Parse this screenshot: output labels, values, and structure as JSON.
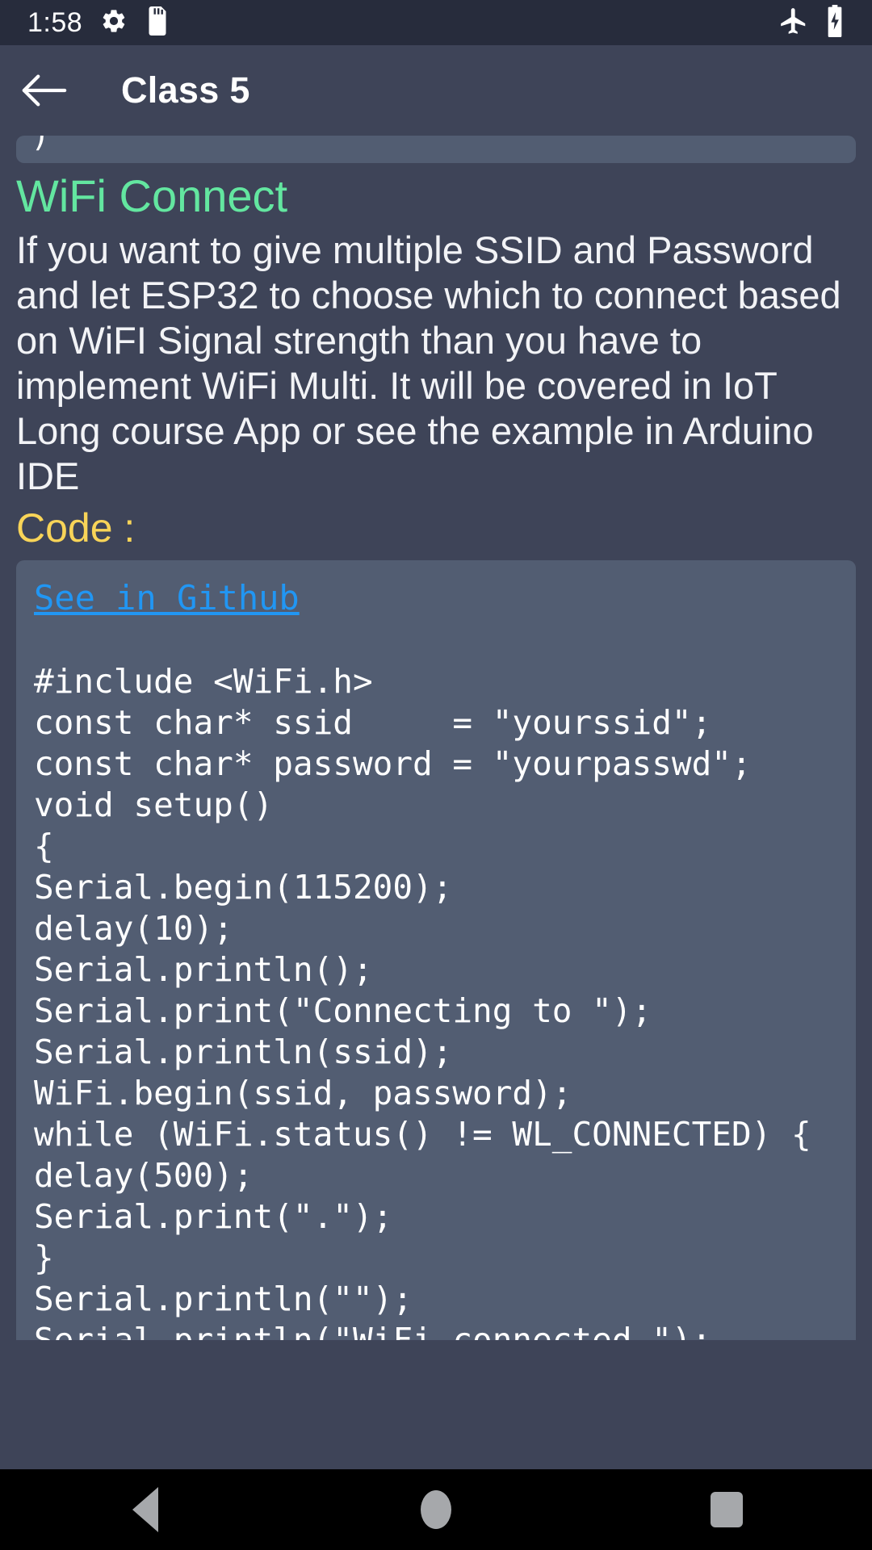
{
  "status_bar": {
    "clock": "1:58",
    "left_icons": [
      "gear-icon",
      "sd-card-icon"
    ],
    "right_icons": [
      "airplane-mode-icon",
      "battery-charging-icon"
    ],
    "background_color": "#272c3c"
  },
  "app_bar": {
    "back_icon": "arrow-left-icon",
    "title": "Class 5",
    "background_color": "#3e4458"
  },
  "content": {
    "previous_code_block_remnant": ")",
    "section_title": "WiFi Connect",
    "section_title_color": "#63e6a0",
    "body_text": "If you want to give multiple SSID and Password and let ESP32 to choose which to connect based on WiFI Signal strength than you have to implement WiFi Multi. It will be covered in IoT Long course App or see the example in Arduino IDE",
    "code_label": "Code :",
    "code_label_color": "#f8d458",
    "code_block": {
      "link_text": "See in Github",
      "link_color": "#2196f3",
      "background_color": "#525d72",
      "code": "#include <WiFi.h>\nconst char* ssid     = \"yourssid\";\nconst char* password = \"yourpasswd\";\nvoid setup()\n{\nSerial.begin(115200);\ndelay(10);\nSerial.println();\nSerial.print(\"Connecting to \");\nSerial.println(ssid);\nWiFi.begin(ssid, password);\nwhile (WiFi.status() != WL_CONNECTED) {\ndelay(500);\nSerial.print(\".\");\n}\nSerial.println(\"\");\nSerial.println(\"WiFi connected.\");"
    }
  },
  "nav_bar": {
    "back_label": "back-button",
    "home_label": "home-button",
    "recents_label": "recents-button",
    "background_color": "#000000"
  }
}
